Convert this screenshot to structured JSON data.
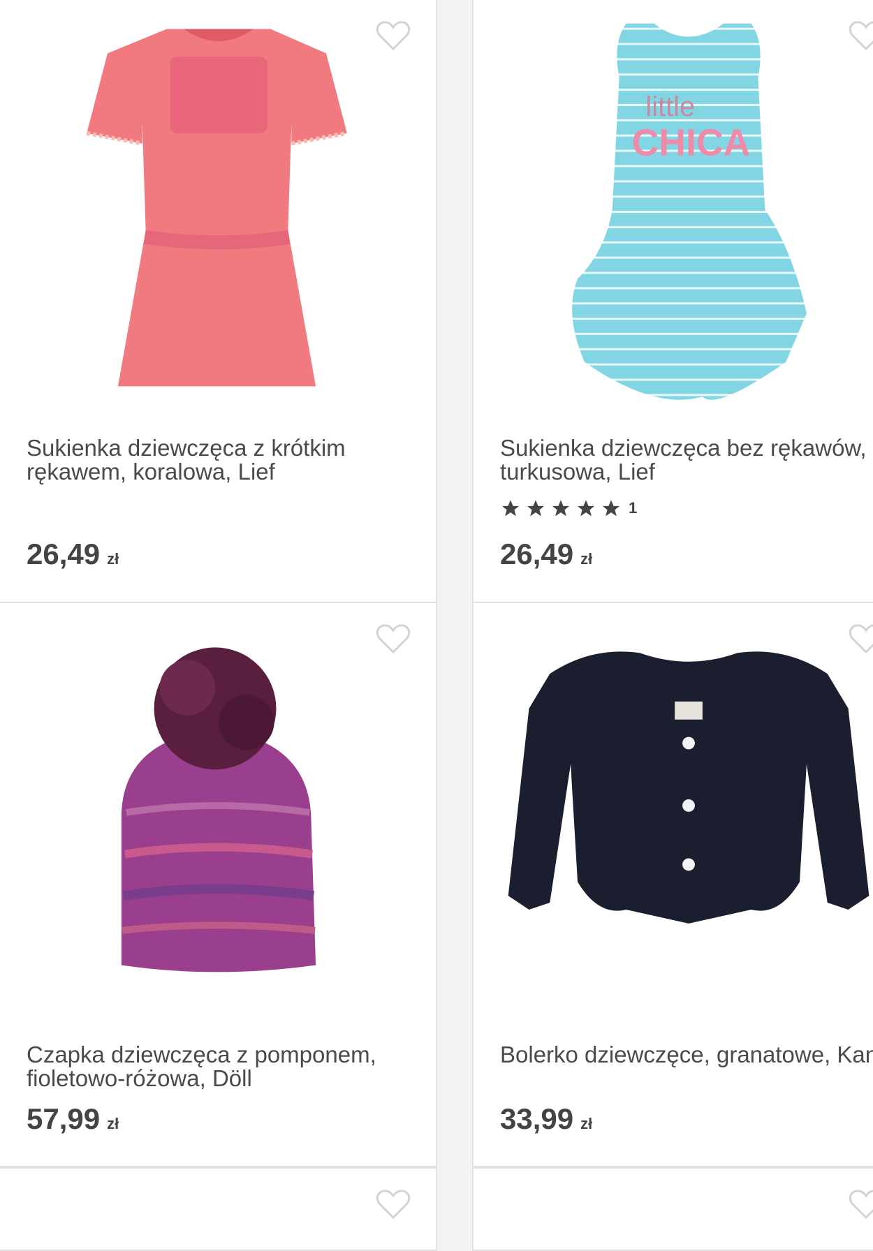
{
  "products": [
    {
      "title": "Sukienka dziewczęca z krótkim rękawem, koralowa, Lief",
      "price": "26,49",
      "currency": "zł",
      "image": "coral-dress"
    },
    {
      "title": "Sukienka dziewczęca bez rękawów, turkusowa, Lief",
      "price": "26,49",
      "currency": "zł",
      "rating": 5,
      "reviews": "1",
      "image": "turquoise-striped-dress"
    },
    {
      "title": "Czapka dziewczęca z pomponem, fioletowo-różowa, Döll",
      "price": "57,99",
      "currency": "zł",
      "image": "knit-hat-pompom"
    },
    {
      "title": "Bolerko dziewczęce, granatowe, Kanz",
      "price": "33,99",
      "currency": "zł",
      "image": "navy-bolero"
    }
  ],
  "colors": {
    "coral": "#f07a80",
    "turquoise": "#7fd6e3",
    "navy": "#1b1e2e",
    "purple": "#9a3f8e"
  }
}
